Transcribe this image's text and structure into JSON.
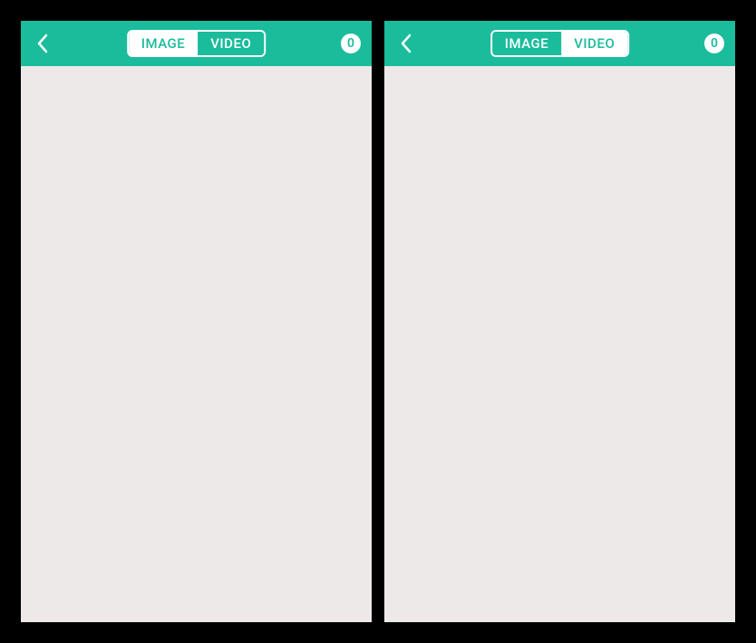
{
  "screens": {
    "left": {
      "tabs": {
        "image_label": "IMAGE",
        "video_label": "VIDEO",
        "active_tab": "image"
      },
      "count": "0"
    },
    "right": {
      "tabs": {
        "image_label": "IMAGE",
        "video_label": "VIDEO",
        "active_tab": "video"
      },
      "count": "0"
    }
  },
  "colors": {
    "primary": "#1abc9c",
    "background": "#ede9e8"
  }
}
